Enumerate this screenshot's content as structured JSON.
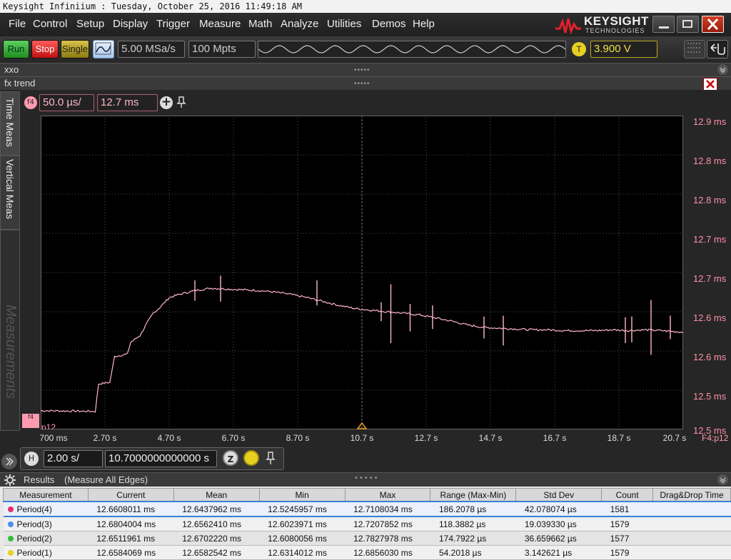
{
  "window": {
    "title": "Keysight Infiniium : Tuesday, October 25, 2016 11:49:18 AM",
    "logo_text": "KEYSIGHT",
    "logo_sub": "TECHNOLOGIES"
  },
  "menu": [
    "File",
    "Control",
    "Setup",
    "Display",
    "Trigger",
    "Measure",
    "Math",
    "Analyze",
    "Utilities",
    "Demos",
    "Help"
  ],
  "toolbar": {
    "run_label": "Run",
    "stop_label": "Stop",
    "single_label": "Single",
    "sample_rate": "5.00 MSa/s",
    "memory_depth": "100 Mpts",
    "trigger_badge": "T",
    "trigger_level": "3.900 V"
  },
  "panels": {
    "xxo_label": "xxo",
    "fx_label": "fx trend"
  },
  "function": {
    "badge": "f4",
    "scale": "50.0 µs/",
    "offset": "12.7 ms",
    "plus": "+"
  },
  "side_tabs": {
    "time_meas": "Time Meas",
    "vertical_meas": "Vertical Meas",
    "measurements": "Measurements"
  },
  "graph": {
    "marker_label": "p12",
    "source_label": "F4:p12",
    "trace_color": "#ffb6c8"
  },
  "chart_data": {
    "type": "line",
    "title": "",
    "xlabel": "",
    "ylabel": "",
    "x_tick_labels": [
      "700 ms",
      "2.70 s",
      "4.70 s",
      "6.70 s",
      "8.70 s",
      "10.7 s",
      "12.7 s",
      "14.7 s",
      "16.7 s",
      "18.7 s",
      "20.7 s"
    ],
    "y_tick_labels": [
      "12.9 ms",
      "12.8 ms",
      "12.8 ms",
      "12.7 ms",
      "12.7 ms",
      "12.6 ms",
      "12.6 ms",
      "12.5 ms",
      "12.5 ms"
    ],
    "xlim": [
      0.7,
      20.7
    ],
    "ylim": [
      12.5,
      12.9
    ],
    "grid": true,
    "series": [
      {
        "x": [
          0.7,
          2.4,
          2.5,
          2.85,
          3.0,
          3.4,
          3.5,
          3.8,
          4.0,
          4.2,
          4.4,
          4.7,
          5.0,
          5.5,
          6.0,
          6.5,
          7.0,
          7.5,
          8.0,
          8.5,
          9.0,
          9.5,
          10.0,
          10.5,
          11.0,
          11.5,
          12.0,
          12.5,
          13.0,
          13.5,
          14.0,
          14.5,
          15.0,
          15.5,
          16.0,
          16.5,
          17.0,
          17.5,
          18.0,
          18.5,
          19.0,
          19.5,
          20.0,
          20.7
        ],
        "y": [
          12.524,
          12.523,
          12.558,
          12.56,
          12.593,
          12.596,
          12.611,
          12.62,
          12.635,
          12.648,
          12.655,
          12.668,
          12.672,
          12.677,
          12.68,
          12.679,
          12.678,
          12.677,
          12.675,
          12.672,
          12.668,
          12.663,
          12.658,
          12.654,
          12.652,
          12.65,
          12.648,
          12.646,
          12.642,
          12.638,
          12.633,
          12.63,
          12.629,
          12.628,
          12.627,
          12.627,
          12.626,
          12.626,
          12.626,
          12.627,
          12.626,
          12.627,
          12.626,
          12.624
        ]
      }
    ],
    "spikes": [
      {
        "x": 5.5,
        "y1": 12.664,
        "y2": 12.69
      },
      {
        "x": 6.3,
        "y1": 12.663,
        "y2": 12.696
      },
      {
        "x": 9.3,
        "y1": 12.658,
        "y2": 12.69
      },
      {
        "x": 11.6,
        "y1": 12.61,
        "y2": 12.685
      },
      {
        "x": 11.3,
        "y1": 12.638,
        "y2": 12.662
      },
      {
        "x": 12.2,
        "y1": 12.625,
        "y2": 12.66
      },
      {
        "x": 12.9,
        "y1": 12.628,
        "y2": 12.658
      },
      {
        "x": 14.5,
        "y1": 12.616,
        "y2": 12.644
      },
      {
        "x": 15.1,
        "y1": 12.607,
        "y2": 12.645
      },
      {
        "x": 18.9,
        "y1": 12.61,
        "y2": 12.643
      },
      {
        "x": 19.1,
        "y1": 12.611,
        "y2": 12.644
      },
      {
        "x": 19.7,
        "y1": 12.595,
        "y2": 12.665
      },
      {
        "x": 20.3,
        "y1": 12.615,
        "y2": 12.645
      }
    ]
  },
  "horizontal": {
    "badge": "H",
    "scale": "2.00 s/",
    "position": "10.7000000000000 s",
    "zoom_badge": "Z"
  },
  "results": {
    "title": "Results",
    "subtitle": "(Measure All Edges)",
    "columns": [
      "Measurement",
      "Current",
      "Mean",
      "Min",
      "Max",
      "Range (Max-Min)",
      "Std Dev",
      "Count",
      "Drag&Drop Time"
    ],
    "rows": [
      {
        "name": "Period(4)",
        "marker": "4",
        "color": "#e0306a",
        "current": "12.6608011 ms",
        "mean": "12.6437962 ms",
        "min": "12.5245957 ms",
        "max": "12.7108034 ms",
        "range": "186.2078 µs",
        "std": "42.078074 µs",
        "count": "1581"
      },
      {
        "name": "Period(3)",
        "marker": "3",
        "color": "#4a8ff0",
        "current": "12.6804004 ms",
        "mean": "12.6562410 ms",
        "min": "12.6023971 ms",
        "max": "12.7207852 ms",
        "range": "118.3882 µs",
        "std": "19.039330 µs",
        "count": "1579"
      },
      {
        "name": "Period(2)",
        "marker": "2",
        "color": "#30c040",
        "current": "12.6511961 ms",
        "mean": "12.6702220 ms",
        "min": "12.6080056 ms",
        "max": "12.7827978 ms",
        "range": "174.7922 µs",
        "std": "36.659662 µs",
        "count": "1577"
      },
      {
        "name": "Period(1)",
        "marker": "1",
        "color": "#e8d020",
        "current": "12.6584069 ms",
        "mean": "12.6582542 ms",
        "min": "12.6314012 ms",
        "max": "12.6856030 ms",
        "range": "54.2018 µs",
        "std": "3.142621 µs",
        "count": "1579"
      }
    ]
  }
}
